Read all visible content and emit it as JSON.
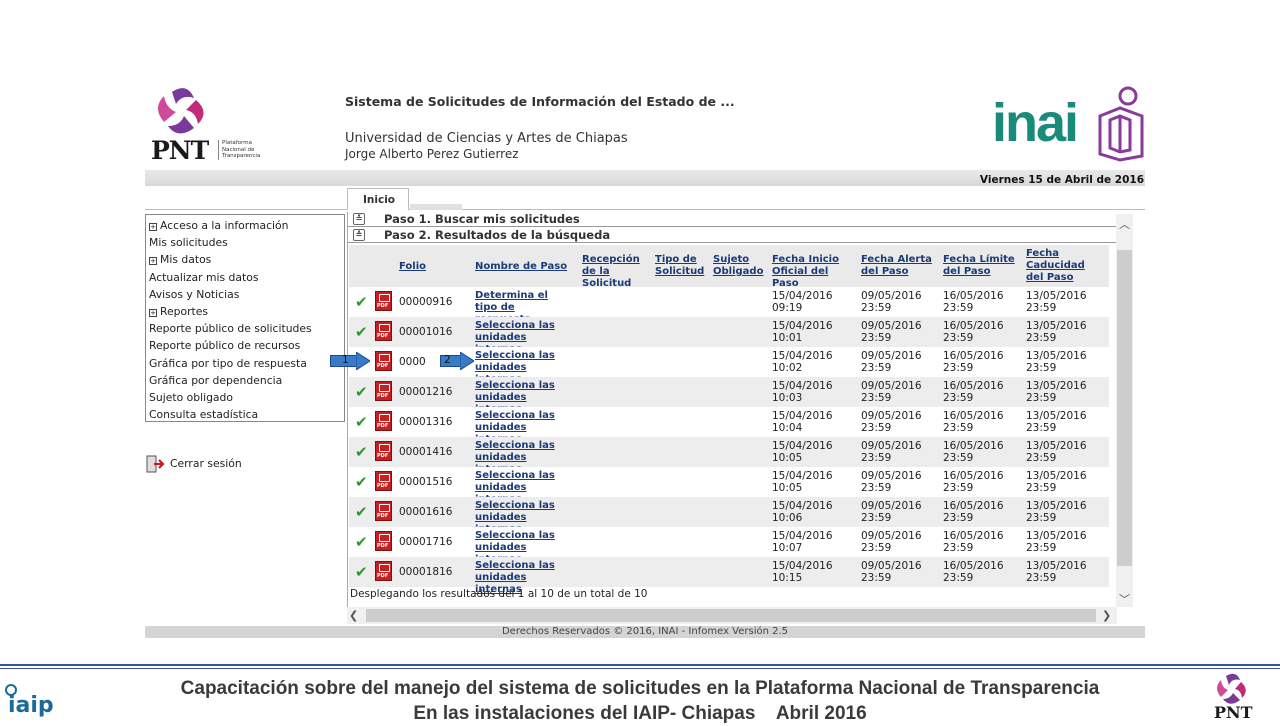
{
  "header": {
    "pnt_logo_text": "PNT",
    "pnt_logo_sub": "Plataforma Nacional de Transparencia",
    "system_title": "Sistema de Solicitudes de Información del Estado de ...",
    "institution": "Universidad de Ciencias y Artes de Chiapas",
    "user": "Jorge Alberto Perez Gutierrez",
    "inai_logo_text": "inai",
    "date": "Viernes 15 de Abril de 2016"
  },
  "tabs": [
    {
      "label": "Inicio"
    }
  ],
  "sidebar": {
    "items": [
      {
        "label": "Acceso a la información",
        "group": true
      },
      {
        "label": "Mis solicitudes",
        "group": false
      },
      {
        "label": "Mis datos",
        "group": true
      },
      {
        "label": "Actualizar mis datos",
        "group": false
      },
      {
        "label": "Avisos y Noticias",
        "group": false
      },
      {
        "label": "Reportes",
        "group": true
      },
      {
        "label": "Reporte público de solicitudes",
        "group": false
      },
      {
        "label": "Reporte público de recursos",
        "group": false
      },
      {
        "label": "Gráfica por tipo de respuesta",
        "group": false
      },
      {
        "label": "Gráfica por dependencia",
        "group": false
      },
      {
        "label": "Sujeto obligado",
        "group": false
      },
      {
        "label": "Consulta estadística",
        "group": false
      }
    ],
    "logout": "Cerrar sesión"
  },
  "steps": {
    "step1": "Paso 1. Buscar mis solicitudes",
    "step2": "Paso 2. Resultados de la búsqueda"
  },
  "table": {
    "headers": {
      "folio": "Folio",
      "nombre_paso": "Nombre de Paso",
      "recepcion": "Recepción de la Solicitud",
      "tipo": "Tipo de Solicitud",
      "sujeto": "Sujeto Obligado",
      "fecha_inicio": "Fecha Inicio Oficial del Paso",
      "fecha_alerta": "Fecha Alerta del Paso",
      "fecha_limite": "Fecha Límite del Paso",
      "fecha_caducidad": "Fecha Caducidad del Paso"
    },
    "pdf_label": "PDF",
    "rows": [
      {
        "folio": "00000916",
        "paso": "Determina el tipo de respuesta",
        "inicio": [
          "15/04/2016",
          "09:19"
        ],
        "alerta": [
          "09/05/2016",
          "23:59"
        ],
        "limite": [
          "16/05/2016",
          "23:59"
        ],
        "caducidad": [
          "13/05/2016",
          "23:59"
        ]
      },
      {
        "folio": "00001016",
        "paso": "Selecciona las unidades internas",
        "inicio": [
          "15/04/2016",
          "10:01"
        ],
        "alerta": [
          "09/05/2016",
          "23:59"
        ],
        "limite": [
          "16/05/2016",
          "23:59"
        ],
        "caducidad": [
          "13/05/2016",
          "23:59"
        ]
      },
      {
        "folio": "0000",
        "paso": "Selecciona las unidades internas",
        "inicio": [
          "15/04/2016",
          "10:02"
        ],
        "alerta": [
          "09/05/2016",
          "23:59"
        ],
        "limite": [
          "16/05/2016",
          "23:59"
        ],
        "caducidad": [
          "13/05/2016",
          "23:59"
        ]
      },
      {
        "folio": "00001216",
        "paso": "Selecciona las unidades internas",
        "inicio": [
          "15/04/2016",
          "10:03"
        ],
        "alerta": [
          "09/05/2016",
          "23:59"
        ],
        "limite": [
          "16/05/2016",
          "23:59"
        ],
        "caducidad": [
          "13/05/2016",
          "23:59"
        ]
      },
      {
        "folio": "00001316",
        "paso": "Selecciona las unidades internas",
        "inicio": [
          "15/04/2016",
          "10:04"
        ],
        "alerta": [
          "09/05/2016",
          "23:59"
        ],
        "limite": [
          "16/05/2016",
          "23:59"
        ],
        "caducidad": [
          "13/05/2016",
          "23:59"
        ]
      },
      {
        "folio": "00001416",
        "paso": "Selecciona las unidades internas",
        "inicio": [
          "15/04/2016",
          "10:05"
        ],
        "alerta": [
          "09/05/2016",
          "23:59"
        ],
        "limite": [
          "16/05/2016",
          "23:59"
        ],
        "caducidad": [
          "13/05/2016",
          "23:59"
        ]
      },
      {
        "folio": "00001516",
        "paso": "Selecciona las unidades internas",
        "inicio": [
          "15/04/2016",
          "10:05"
        ],
        "alerta": [
          "09/05/2016",
          "23:59"
        ],
        "limite": [
          "16/05/2016",
          "23:59"
        ],
        "caducidad": [
          "13/05/2016",
          "23:59"
        ]
      },
      {
        "folio": "00001616",
        "paso": "Selecciona las unidades internas",
        "inicio": [
          "15/04/2016",
          "10:06"
        ],
        "alerta": [
          "09/05/2016",
          "23:59"
        ],
        "limite": [
          "16/05/2016",
          "23:59"
        ],
        "caducidad": [
          "13/05/2016",
          "23:59"
        ]
      },
      {
        "folio": "00001716",
        "paso": "Selecciona las unidades internas",
        "inicio": [
          "15/04/2016",
          "10:07"
        ],
        "alerta": [
          "09/05/2016",
          "23:59"
        ],
        "limite": [
          "16/05/2016",
          "23:59"
        ],
        "caducidad": [
          "13/05/2016",
          "23:59"
        ]
      },
      {
        "folio": "00001816",
        "paso": "Selecciona las unidades internas",
        "inicio": [
          "15/04/2016",
          "10:15"
        ],
        "alerta": [
          "09/05/2016",
          "23:59"
        ],
        "limite": [
          "16/05/2016",
          "23:59"
        ],
        "caducidad": [
          "13/05/2016",
          "23:59"
        ]
      }
    ],
    "result_text": "Desplegando los resultados del 1 al 10 de un total de 10"
  },
  "annotations": {
    "arrow1": "1",
    "arrow2": "2"
  },
  "copyright": "Derechos Reservados © 2016, INAI - Infomex Versión 2.5",
  "footer": {
    "line1": "Capacitación sobre del manejo del sistema de solicitudes en la Plataforma Nacional de Transparencia",
    "line2": "En las instalaciones del IAIP- Chiapas    Abril 2016",
    "iaip_logo_text": "iaip",
    "pnt_logo_text": "PNT"
  },
  "colors": {
    "link": "#1a3a7a",
    "check": "#2a9a2a",
    "pdf": "#c82020",
    "inai": "#1a8a7a",
    "inai_purple": "#8a3a9a",
    "footer_rule": "#3b4fa8"
  }
}
